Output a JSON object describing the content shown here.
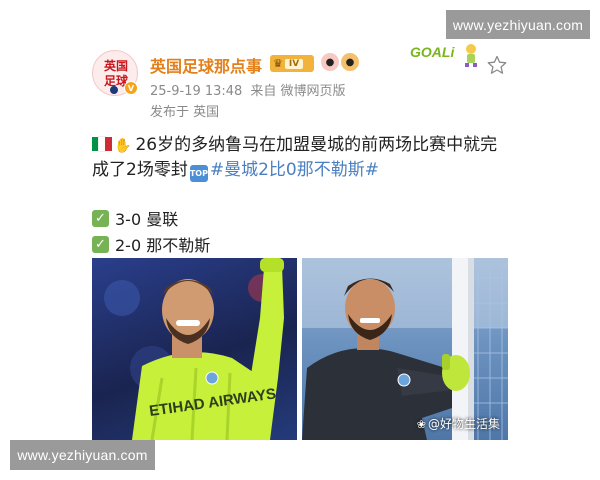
{
  "watermarks": {
    "top": "www.yezhiyuan.com",
    "bottom": "www.yezhiyuan.com"
  },
  "author": {
    "avatar_line1": "英国",
    "avatar_line2": "足球",
    "verified_badge": "V",
    "name": "英国足球那点事",
    "level_label": "IV"
  },
  "post_meta": {
    "datetime": "25-9-19 13:48",
    "source": "来自 微博网页版",
    "location": "发布于 英国"
  },
  "header_badge": {
    "text": "GOALi"
  },
  "post": {
    "line1_text": "26岁的多纳鲁马在加盟曼城的前两场比赛中就完",
    "line2_text": "成了2场零封",
    "top_icon_label": "TOP",
    "hashtag": "#曼城2比0那不勒斯#",
    "results": [
      {
        "check": "✓",
        "text": "3-0 曼联"
      },
      {
        "check": "✓",
        "text": "2-0 那不勒斯"
      }
    ]
  },
  "photos": {
    "photo1_sponsor": "ETIHAD AIRWAYS",
    "photo2_caption": "@好物生活集"
  },
  "colors": {
    "username": "#e4801a",
    "hashtag": "#4a7fc1",
    "meta": "#8a8a8a",
    "kit_green": "#c6f03a",
    "check_green": "#77b255"
  },
  "icons": {
    "italy_flag": "italy-flag-icon",
    "gloves": "gloves-icon",
    "top": "top-arrow-icon",
    "check": "check-mark-icon",
    "star": "star-outline-icon"
  }
}
